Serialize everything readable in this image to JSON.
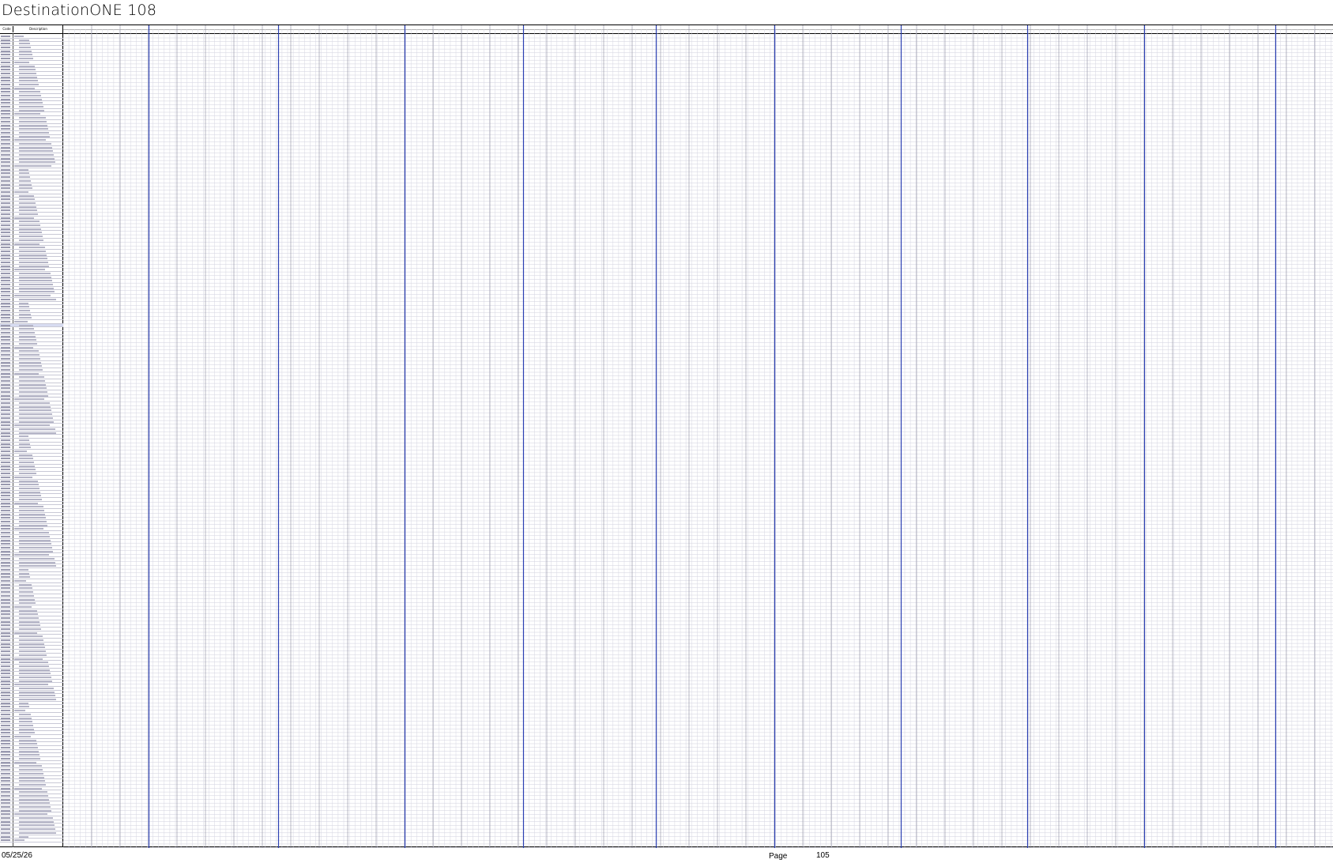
{
  "document": {
    "title": "DestinationONE 108",
    "columns": {
      "code_header": "Code",
      "description_header": "Description"
    },
    "footer": {
      "date": "05/25/26",
      "page_label": "Page",
      "page_number": "105"
    }
  },
  "colors": {
    "grid_line": "#c9c9d6",
    "group_separator": "#2b3fb2",
    "header_rule": "#000000"
  }
}
